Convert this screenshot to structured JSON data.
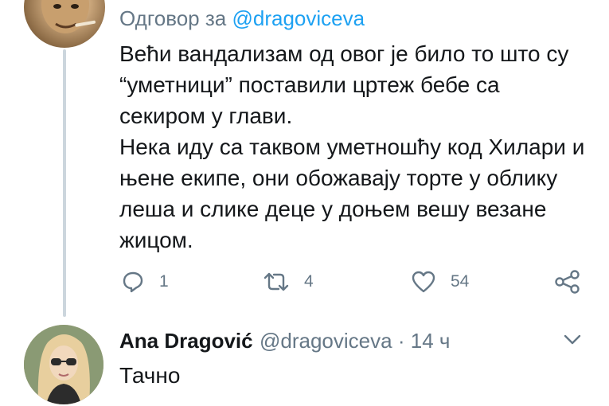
{
  "tweet1": {
    "reply_prefix": "Одговор за",
    "reply_mention": "@dragoviceva",
    "paragraph1": "Већи вандализам од овог је било то што су “уметници” поставили цртеж бебе са секиром у глави.",
    "paragraph2": "Нека иду са таквом уметношћу код Хилари и њене екипе, они обожавају торте у облику леша и слике деце у доњем вешу везане жицом.",
    "reply_count": "1",
    "retweet_count": "4",
    "like_count": "54",
    "icons": [
      "reply-icon",
      "retweet-icon",
      "like-icon",
      "share-icon"
    ]
  },
  "tweet2": {
    "name": "Ana Dragović",
    "handle": "@dragoviceva",
    "separator": "·",
    "time": "14 ч",
    "text": "Тачно",
    "icons": [
      "chevron-down-icon"
    ]
  },
  "colors": {
    "accent": "#1da1f2",
    "secondary_text": "#657786",
    "thread_line": "#ccd6dd"
  }
}
